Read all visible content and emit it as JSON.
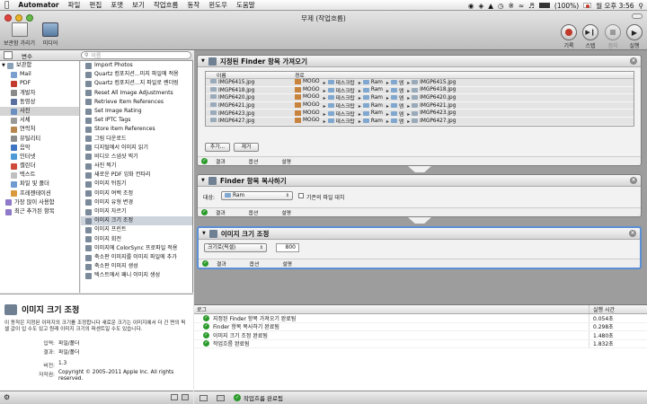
{
  "menubar": {
    "app": "Automator",
    "items": [
      "파일",
      "편집",
      "포맷",
      "보기",
      "작업흐름",
      "동작",
      "윈도우",
      "도움말"
    ],
    "battery": "(100%)",
    "clock": "월 오후 3:56"
  },
  "window": {
    "title": "무제 (작업흐름)"
  },
  "toolbar": {
    "hide_library": "보관함 가리기",
    "media": "미디어",
    "record": "기록",
    "step": "스텝",
    "stop": "정지",
    "run": "실행"
  },
  "library": {
    "col_variables": "변수",
    "search_placeholder": "이름",
    "tree": [
      {
        "label": "보관함",
        "color": "#8aa1b8"
      },
      {
        "label": "Mail",
        "color": "#7aa0d0"
      },
      {
        "label": "PDF",
        "color": "#c23a2e"
      },
      {
        "label": "개발자",
        "color": "#8a8a8a"
      },
      {
        "label": "동영상",
        "color": "#5a6fa0"
      },
      {
        "label": "사진",
        "color": "#6b8fbf"
      },
      {
        "label": "서체",
        "color": "#9a9a9a"
      },
      {
        "label": "연락처",
        "color": "#b8864f"
      },
      {
        "label": "뮤틸리티",
        "color": "#8c8c8c"
      },
      {
        "label": "음악",
        "color": "#3f74c2"
      },
      {
        "label": "인터넷",
        "color": "#4e9ad6"
      },
      {
        "label": "캘린더",
        "color": "#d04a3a"
      },
      {
        "label": "텍스트",
        "color": "#c0c0c0"
      },
      {
        "label": "파일 및 폴더",
        "color": "#6f9bd0"
      },
      {
        "label": "프레젠테이션",
        "color": "#d89a3a"
      },
      {
        "label": "가장 많이 사용함",
        "color": "#8e7ac8"
      },
      {
        "label": "최근 추가된 항목",
        "color": "#8e7ac8"
      }
    ],
    "actions": [
      "Import Photos",
      "Quartz 컴포지션...미지 파일에 적용",
      "Quartz 컴포지션...지 파일로 렌더링",
      "Reset All Image Adjustments",
      "Retrieve Item References",
      "Set Image Rating",
      "Set IPTC Tags",
      "Store Item References",
      "그림 다운로드",
      "디지털에서 이미지 읽기",
      "비디오 스냅샷 찍기",
      "사진 찍기",
      "새로운 PDF 잉화 컨타리",
      "이미지 뒤집기",
      "이미지 여백 조정",
      "이미지 유형 변경",
      "이미지 자르기",
      "이미지 크기 조정",
      "이미지 프린트",
      "이미지 회전",
      "이미지에 ColorSync 프로파일 적용",
      "축소판 이미지를 이미지 파일에 추가",
      "축소판 이미지 생성",
      "텍스트에서 패니 이미지 생성"
    ]
  },
  "description": {
    "title": "이미지 크기 조정",
    "text": "이 동작은 지정된 이미지의 크기를 조정합니다 새로운 크기는 이미지에서 더 긴 면의 픽셀 값이 입 수도 있고 원래 이미지 크기의 퍼센트일 수도 있습니다.",
    "input_label": "입력:",
    "input_value": "파일/폴더",
    "result_label": "결과:",
    "result_value": "파일/폴더",
    "version_label": "버전:",
    "version_value": "1.3",
    "copyright_label": "저작권:",
    "copyright_value": "Copyright © 2005–2011 Apple Inc. All rights reserved."
  },
  "action1": {
    "title": "지정된 Finder 항목 가져오기",
    "col_name": "이름",
    "col_path": "경로",
    "path_home": "MOGO",
    "path_desktop": "데스크탑",
    "path_ram": "Ram",
    "path_folder": "엠",
    "files": [
      "IMGP6415.jpg",
      "IMGP6418.jpg",
      "IMGP6420.jpg",
      "IMGP6421.jpg",
      "IMGP6423.jpg",
      "IMGP6427.jpg"
    ],
    "add_button": "추가...",
    "remove_button": "제거"
  },
  "action2": {
    "title": "Finder 항목 복사하기",
    "target_label": "대상:",
    "target_value": "Ram",
    "replace_label": "기존의 파일 대치"
  },
  "action3": {
    "title": "이미지 크기 조정",
    "mode_value": "크기로(픽셀)",
    "size_value": "800"
  },
  "action_footer": {
    "results": "결과",
    "options": "옵션",
    "description": "설명"
  },
  "log": {
    "col_log": "로그",
    "col_time": "실행 시간",
    "rows": [
      {
        "text": "지정된 Finder 항목 가져오기 완료됨",
        "time": "0.054초"
      },
      {
        "text": "Finder 항목 복사하기 완료됨",
        "time": "0.298초"
      },
      {
        "text": "이미지 크기 조정 완료됨",
        "time": "1.480초"
      },
      {
        "text": "작업흐름 완료됨",
        "time": "1.832초"
      }
    ]
  },
  "status": {
    "text": "작업흐름 완료됨"
  },
  "colors": {
    "check_green": "#2a9a2a",
    "record_red": "#c0392b"
  }
}
